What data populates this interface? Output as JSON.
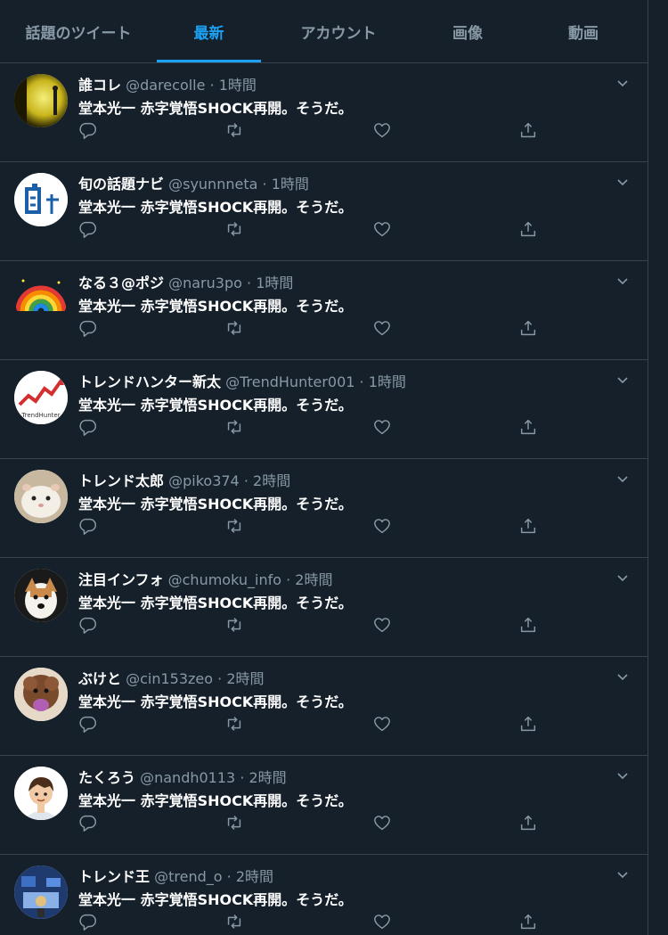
{
  "tabs": [
    {
      "label": "話題のツイート",
      "active": false
    },
    {
      "label": "最新",
      "active": true
    },
    {
      "label": "アカウント",
      "active": false
    },
    {
      "label": "画像",
      "active": false
    },
    {
      "label": "動画",
      "active": false
    }
  ],
  "dot": "·",
  "colors": {
    "background": "#15202b",
    "accent": "#1da1f2",
    "muted": "#8899a6",
    "border": "#38444d"
  },
  "tweets": [
    {
      "name": "誰コレ",
      "handle": "@darecolle",
      "time": "1時間",
      "text": "堂本光一 赤字覚悟SHOCK再開。そうだ。"
    },
    {
      "name": "旬の話題ナビ",
      "handle": "@syunnneta",
      "time": "1時間",
      "text": "堂本光一 赤字覚悟SHOCK再開。そうだ。"
    },
    {
      "name": "なる３@ポジ",
      "handle": "@naru3po",
      "time": "1時間",
      "text": "堂本光一 赤字覚悟SHOCK再開。そうだ。"
    },
    {
      "name": "トレンドハンター新太",
      "handle": "@TrendHunter001",
      "time": "1時間",
      "text": "堂本光一 赤字覚悟SHOCK再開。そうだ。",
      "avatar_text": "TrendHunter"
    },
    {
      "name": "トレンド太郎",
      "handle": "@piko374",
      "time": "2時間",
      "text": "堂本光一 赤字覚悟SHOCK再開。そうだ。"
    },
    {
      "name": "注目インフォ",
      "handle": "@chumoku_info",
      "time": "2時間",
      "text": "堂本光一 赤字覚悟SHOCK再開。そうだ。"
    },
    {
      "name": "ぶけと",
      "handle": "@cin153zeo",
      "time": "2時間",
      "text": "堂本光一 赤字覚悟SHOCK再開。そうだ。"
    },
    {
      "name": "たくろう",
      "handle": "@nandh0113",
      "time": "2時間",
      "text": "堂本光一 赤字覚悟SHOCK再開。そうだ。"
    },
    {
      "name": "トレンド王",
      "handle": "@trend_o",
      "time": "2時間",
      "text": "堂本光一 赤字覚悟SHOCK再開。そうだ。"
    }
  ]
}
